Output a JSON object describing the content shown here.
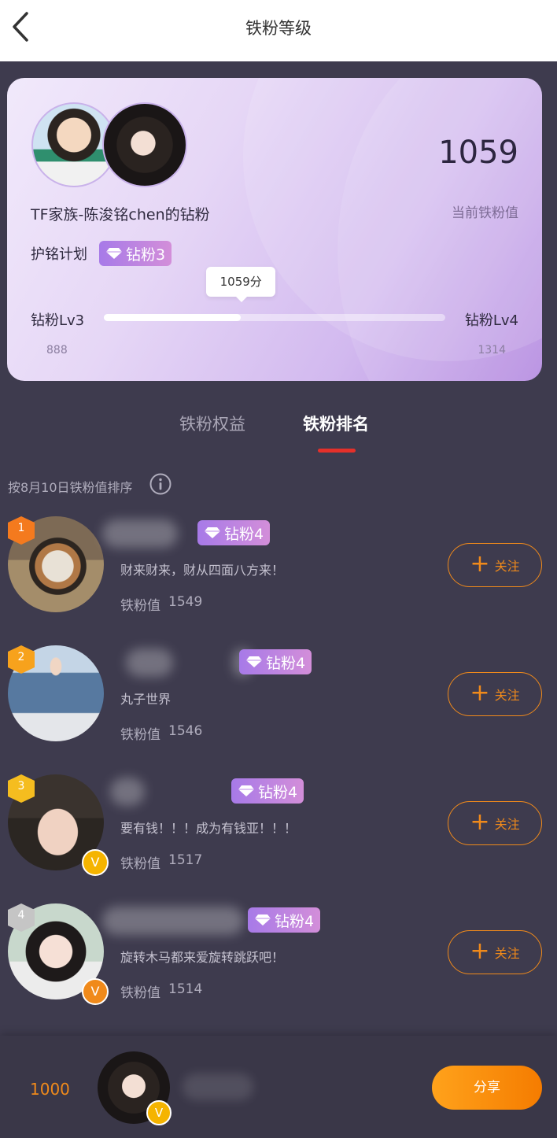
{
  "header": {
    "title": "铁粉等级"
  },
  "card": {
    "fan_name": "TF家族-陈浚铭chen的钻粉",
    "score": "1059",
    "score_label": "当前铁粉值",
    "plan_label": "护铭计划",
    "plan_badge": "钻粉3",
    "tooltip": "1059分",
    "level_left": "钻粉Lv3",
    "level_right": "钻粉Lv4",
    "range_min": "888",
    "range_max": "1314",
    "progress": 1059
  },
  "tabs": [
    {
      "label": "铁粉权益",
      "active": false
    },
    {
      "label": "铁粉排名",
      "active": true
    }
  ],
  "sort_label": "按8月10日铁粉值排序",
  "value_label": "铁粉值",
  "follow_label": "关注",
  "ranking": [
    {
      "rank": "1",
      "badge": "钻粉4",
      "signature": "财来财来，财从四面八方来！",
      "value": "1549",
      "rank_color": "#f47a1e",
      "verified": false
    },
    {
      "rank": "2",
      "badge": "钻粉4",
      "signature": "丸子世界",
      "value": "1546",
      "rank_color": "#f7a21c",
      "verified": false
    },
    {
      "rank": "3",
      "badge": "钻粉4",
      "signature": "要有钱！！！成为有钱亚！！！",
      "value": "1517",
      "rank_color": "#f5bd1f",
      "verified": true,
      "verified_color": "#f5b400"
    },
    {
      "rank": "4",
      "badge": "钻粉4",
      "signature": "旋转木马都来爱旋转跳跃吧！",
      "value": "1514",
      "rank_color": "#c5c5c5",
      "verified": true,
      "verified_color": "#f08a1b"
    }
  ],
  "bottom": {
    "my_score": "1000",
    "share_label": "分享"
  },
  "colors": {
    "accent": "#f08a1b",
    "tab_underline": "#e5302a",
    "badge_start": "#a77ae8",
    "badge_end": "#d38ed9"
  }
}
